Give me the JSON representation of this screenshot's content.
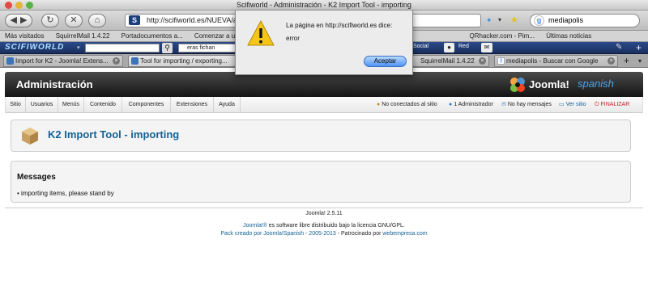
{
  "window": {
    "title": "Scifiworld - Administración - K2 Import Tool - importing"
  },
  "nav": {
    "url": "http://scifiworld.es/NUEVA/adr",
    "search": "mediapolis"
  },
  "bookmarks": [
    "Más visitados",
    "SquirrelMail 1.4.22",
    "Portadocumentos a...",
    "Comenzar a usar",
    "QRhacker.com - Pim...",
    "Últimas noticias"
  ],
  "extbar": {
    "logo": "SCIFIWORLD",
    "field_text": "eras fichan",
    "social": "Social",
    "red": "Red"
  },
  "tabs": [
    "Import for K2 - Joomla! Extens...",
    "Tool for importing / exporting...",
    "SquirrelMail 1.4.22",
    "mediapolis - Buscar con Google"
  ],
  "admin": {
    "title": "Administración",
    "logo_word": "Joomla!",
    "logo_lang": "spanish"
  },
  "menu": [
    "Sitio",
    "Usuarios",
    "Menús",
    "Contenido",
    "Componentes",
    "Extensiones",
    "Ayuda"
  ],
  "status": {
    "connected": "No conectados al sitio",
    "admins": "1 Administrador",
    "messages": "No hay mensajes",
    "view": "Ver sitio",
    "logout": "FINALIZAR"
  },
  "component": {
    "title": "K2 Import Tool - importing"
  },
  "messages": {
    "heading": "Messages",
    "item": "importing items, please stand by"
  },
  "footer": {
    "version": "Joomla! 2.5.11",
    "license_link": "Joomla!®",
    "license_text": " es software libre distribuido bajo la licencia GNU/GPL.",
    "pack": "Pack creado por Joomla!Spanish - 2005-2013",
    "sponsor_text": " - Patrocinado por ",
    "sponsor_link": "webempresa.com"
  },
  "dialog": {
    "message": "La página en http://scifiworld.es dice:",
    "error": "error",
    "ok": "Aceptar"
  },
  "colors": {
    "joomla_blue": "#146295",
    "logout_red": "#d02020",
    "dialog_ok": "#4f93f3"
  }
}
